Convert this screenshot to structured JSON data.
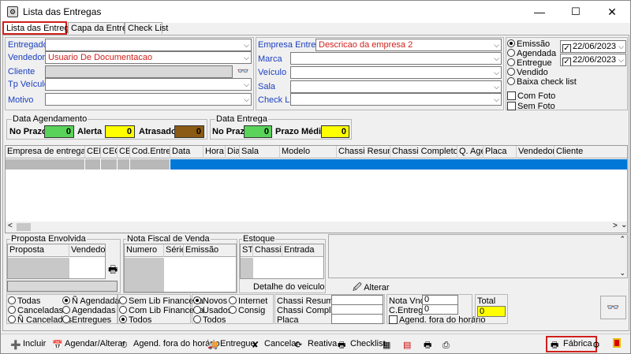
{
  "window": {
    "title": "Lista das Entregas",
    "min": "—",
    "max": "☐",
    "close": "✕"
  },
  "tabs": [
    "Lista das Entregas",
    "Capa da Entrega",
    "Check List"
  ],
  "filters_left": {
    "entregador": {
      "label": "Entregador",
      "value": ""
    },
    "vendedor": {
      "label": "Vendedor",
      "value": "Usuario De Documentacao"
    },
    "cliente": {
      "label": "Cliente",
      "value": ""
    },
    "tp_veiculo": {
      "label": "Tp Veículo",
      "value": ""
    },
    "motivo": {
      "label": "Motivo",
      "value": ""
    }
  },
  "filters_mid": {
    "empresa": {
      "label": "Empresa Entrega",
      "value": "Descricao da empresa 2"
    },
    "marca": {
      "label": "Marca",
      "value": ""
    },
    "veiculo": {
      "label": "Veículo",
      "value": ""
    },
    "sala": {
      "label": "Sala",
      "value": ""
    },
    "checklist": {
      "label": "Check List",
      "value": ""
    }
  },
  "status_radios": [
    {
      "label": "Emissão",
      "checked": true
    },
    {
      "label": "Agendada",
      "checked": false
    },
    {
      "label": "Entregue",
      "checked": false
    },
    {
      "label": "Vendido",
      "checked": false
    },
    {
      "label": "Baixa check list",
      "checked": false
    }
  ],
  "dates": {
    "from": "22/06/2023",
    "to": "22/06/2023"
  },
  "photo_checks": [
    {
      "label": "Com Foto",
      "checked": false
    },
    {
      "label": "Sem Foto",
      "checked": false
    }
  ],
  "data_agendamento": {
    "title": "Data Agendamento",
    "no_prazo": {
      "label": "No Prazo",
      "value": "0",
      "color": "#5ad35a"
    },
    "alerta": {
      "label": "Alerta",
      "value": "0",
      "color": "#ffff00"
    },
    "atrasado": {
      "label": "Atrasado",
      "value": "0",
      "color": "#8b5a14"
    }
  },
  "data_entrega": {
    "title": "Data Entrega",
    "no_prazo": {
      "label": "No Prazo",
      "value": "0",
      "color": "#5ad35a"
    },
    "prazo_medio": {
      "label": "Prazo Médio",
      "value": "0",
      "color": "#ffff00"
    }
  },
  "main_grid": {
    "columns": [
      "Empresa de entrega",
      "CEE",
      "CEO",
      "CE",
      "Cod.Entrega",
      "Data",
      "Hora",
      "Dia",
      "Sala",
      "Modelo",
      "Chassi Resumido",
      "Chassi Completo",
      "Q. Age",
      "Placa",
      "Vendedor",
      "Cliente"
    ],
    "selection_color": "#0078d7"
  },
  "proposta": {
    "title": "Proposta Envolvida",
    "columns": [
      "Proposta",
      "Vendedor"
    ]
  },
  "nota_fiscal": {
    "title": "Nota Fiscal de Venda",
    "columns": [
      "Numero",
      "Série",
      "Emissão"
    ]
  },
  "estoque": {
    "title": "Estoque",
    "columns": [
      "ST",
      "Chassi",
      "Entrada"
    ],
    "detalhe": "Detalhe do veiculo"
  },
  "alterar_label": "Alterar",
  "bottom_radios_1": [
    {
      "label": "Todas",
      "checked": false
    },
    {
      "label": "Canceladas",
      "checked": false
    },
    {
      "label": "Ñ Canceladas",
      "checked": false
    }
  ],
  "bottom_radios_2": [
    {
      "label": "Ñ Agendadas",
      "checked": true
    },
    {
      "label": "Agendadas",
      "checked": false
    },
    {
      "label": "Entregues",
      "checked": false
    }
  ],
  "bottom_radios_3": [
    {
      "label": "Sem Lib Financeira",
      "checked": false
    },
    {
      "label": "Com Lib Financeira",
      "checked": false
    },
    {
      "label": "Todos",
      "checked": true
    }
  ],
  "bottom_radios_4": [
    {
      "label": "Novos",
      "checked": true
    },
    {
      "label": "Usados",
      "checked": false
    },
    {
      "label": "Todos",
      "checked": false
    }
  ],
  "bottom_radios_5": [
    {
      "label": "Internet",
      "checked": false
    },
    {
      "label": "Consig",
      "checked": false
    }
  ],
  "chassi_fields": {
    "resumido": "Chassi Resumido",
    "completo": "Chassi Completo",
    "placa": "Placa"
  },
  "nota_vnd": {
    "label": "Nota Vnd",
    "value": "0"
  },
  "c_entrega": {
    "label": "C.Entrega",
    "value": "0"
  },
  "agend_fora": {
    "label": "Agend. fora do horário",
    "checked": false
  },
  "total": {
    "label": "Total",
    "value": "0"
  },
  "toolbar": {
    "incluir": "Incluir",
    "agendar": "Agendar/Alterar",
    "agend_fora": "Agend. fora do horário",
    "entregue": "Entregue",
    "cancelar": "Cancelar",
    "reativa": "Reativa",
    "checklist": "Checklist",
    "fabrica": "Fábrica"
  }
}
